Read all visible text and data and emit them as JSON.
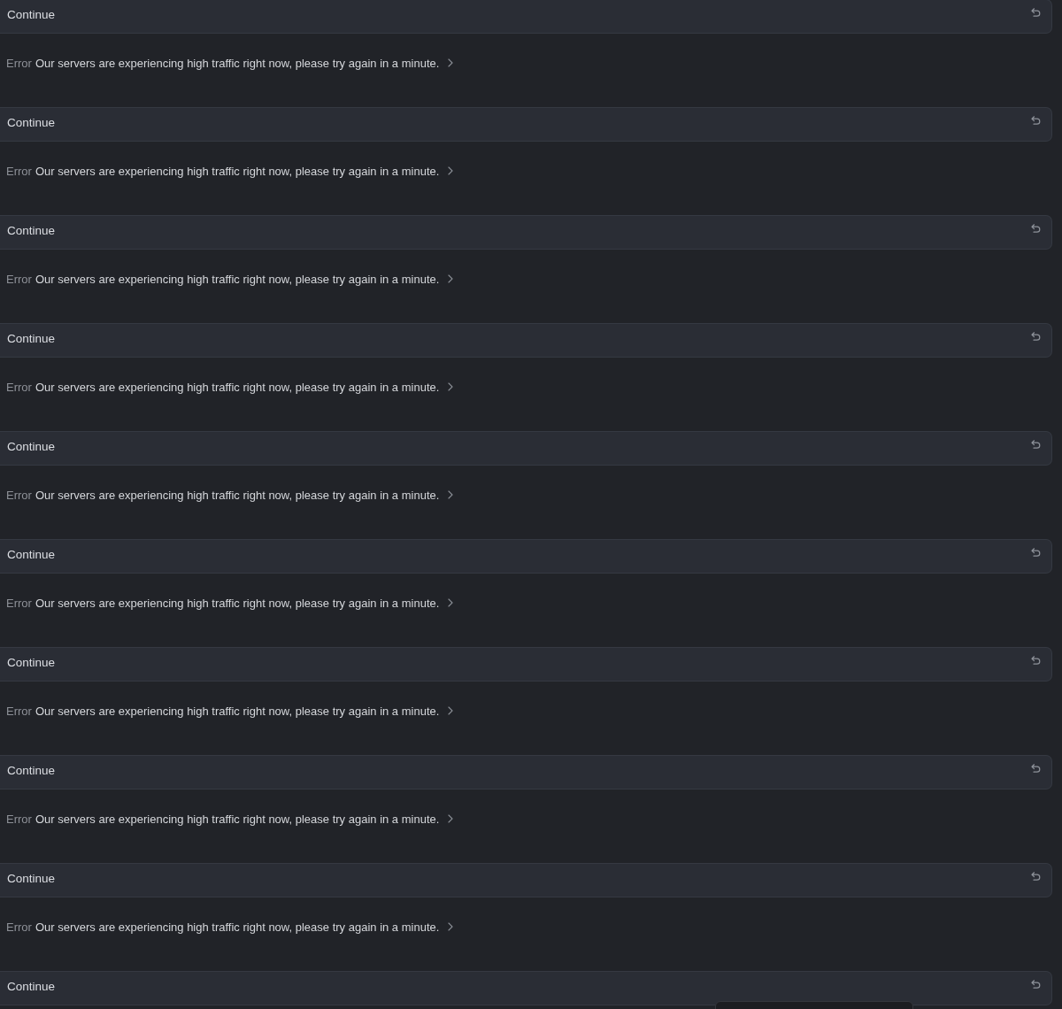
{
  "conversation": [
    {
      "kind": "prompt",
      "text": "Continue"
    },
    {
      "kind": "error",
      "label": "Error",
      "message": "Our servers are experiencing high traffic right now, please try again in a minute."
    },
    {
      "kind": "prompt",
      "text": "Continue"
    },
    {
      "kind": "error",
      "label": "Error",
      "message": "Our servers are experiencing high traffic right now, please try again in a minute."
    },
    {
      "kind": "prompt",
      "text": "Continue"
    },
    {
      "kind": "error",
      "label": "Error",
      "message": "Our servers are experiencing high traffic right now, please try again in a minute."
    },
    {
      "kind": "prompt",
      "text": "Continue"
    },
    {
      "kind": "error",
      "label": "Error",
      "message": "Our servers are experiencing high traffic right now, please try again in a minute."
    },
    {
      "kind": "prompt",
      "text": "Continue"
    },
    {
      "kind": "error",
      "label": "Error",
      "message": "Our servers are experiencing high traffic right now, please try again in a minute."
    },
    {
      "kind": "prompt",
      "text": "Continue"
    },
    {
      "kind": "error",
      "label": "Error",
      "message": "Our servers are experiencing high traffic right now, please try again in a minute."
    },
    {
      "kind": "prompt",
      "text": "Continue"
    },
    {
      "kind": "error",
      "label": "Error",
      "message": "Our servers are experiencing high traffic right now, please try again in a minute."
    },
    {
      "kind": "prompt",
      "text": "Continue"
    },
    {
      "kind": "error",
      "label": "Error",
      "message": "Our servers are experiencing high traffic right now, please try again in a minute."
    },
    {
      "kind": "prompt",
      "text": "Continue"
    },
    {
      "kind": "error",
      "label": "Error",
      "message": "Our servers are experiencing high traffic right now, please try again in a minute."
    },
    {
      "kind": "prompt",
      "text": "Continue"
    }
  ]
}
